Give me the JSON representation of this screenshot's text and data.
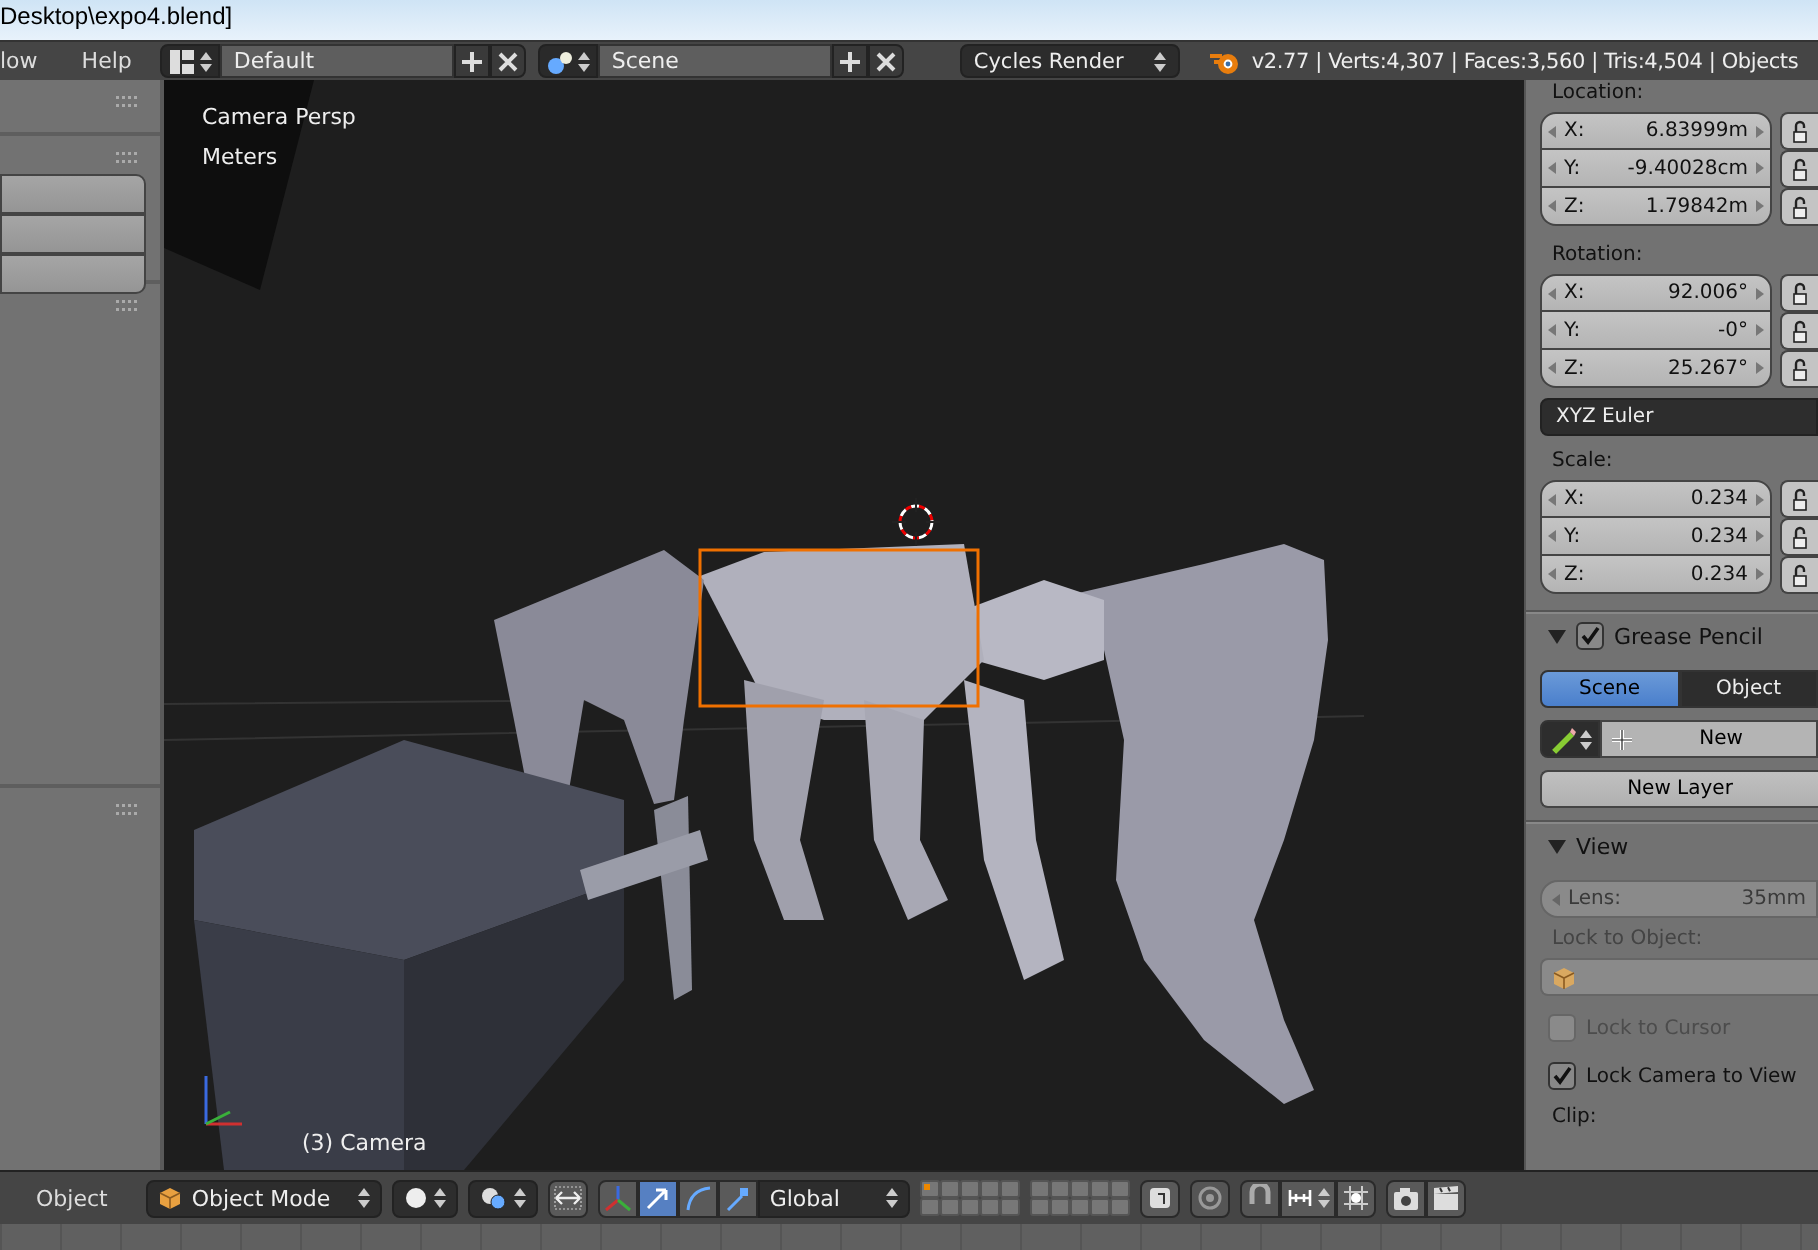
{
  "title_bar": {
    "title": "Desktop\\expo4.blend]"
  },
  "top_header": {
    "menus": [
      "low",
      "Help"
    ],
    "layout": "Default",
    "scene": "Scene",
    "render_engine": "Cycles Render",
    "stats": "v2.77 | Verts:4,307 | Faces:3,560 | Tris:4,504 | Objects"
  },
  "viewport": {
    "view_name": "Camera Persp",
    "units": "Meters",
    "object_label": "(3) Camera"
  },
  "properties": {
    "groups": [
      {
        "label": "Location:",
        "fields": [
          {
            "axis": "X:",
            "value": "6.83999m"
          },
          {
            "axis": "Y:",
            "value": "-9.40028cm"
          },
          {
            "axis": "Z:",
            "value": "1.79842m"
          }
        ]
      },
      {
        "label": "Rotation:",
        "fields": [
          {
            "axis": "X:",
            "value": "92.006°"
          },
          {
            "axis": "Y:",
            "value": "-0°"
          },
          {
            "axis": "Z:",
            "value": "25.267°"
          }
        ],
        "mode": "XYZ Euler"
      },
      {
        "label": "Scale:",
        "fields": [
          {
            "axis": "X:",
            "value": "0.234"
          },
          {
            "axis": "Y:",
            "value": "0.234"
          },
          {
            "axis": "Z:",
            "value": "0.234"
          }
        ]
      }
    ],
    "grease_pencil": {
      "title": "Grease Pencil",
      "expanded": true,
      "checked": true,
      "tabs": [
        {
          "label": "Scene",
          "selected": true
        },
        {
          "label": "Object",
          "selected": false
        }
      ],
      "new_button": "New",
      "new_layer_button": "New Layer"
    },
    "view": {
      "title": "View",
      "expanded": true,
      "lens": {
        "label": "Lens:",
        "value": "35mm",
        "disabled": true
      },
      "lock_to_object": "Lock to Object:",
      "options": [
        {
          "label": "Lock to Cursor",
          "checked": false,
          "disabled": true
        },
        {
          "label": "Lock Camera to View",
          "checked": true,
          "disabled": false
        }
      ],
      "clip": "Clip:"
    }
  },
  "bottom_header": {
    "menu": "Object",
    "mode": "Object Mode",
    "orientation": "Global"
  }
}
